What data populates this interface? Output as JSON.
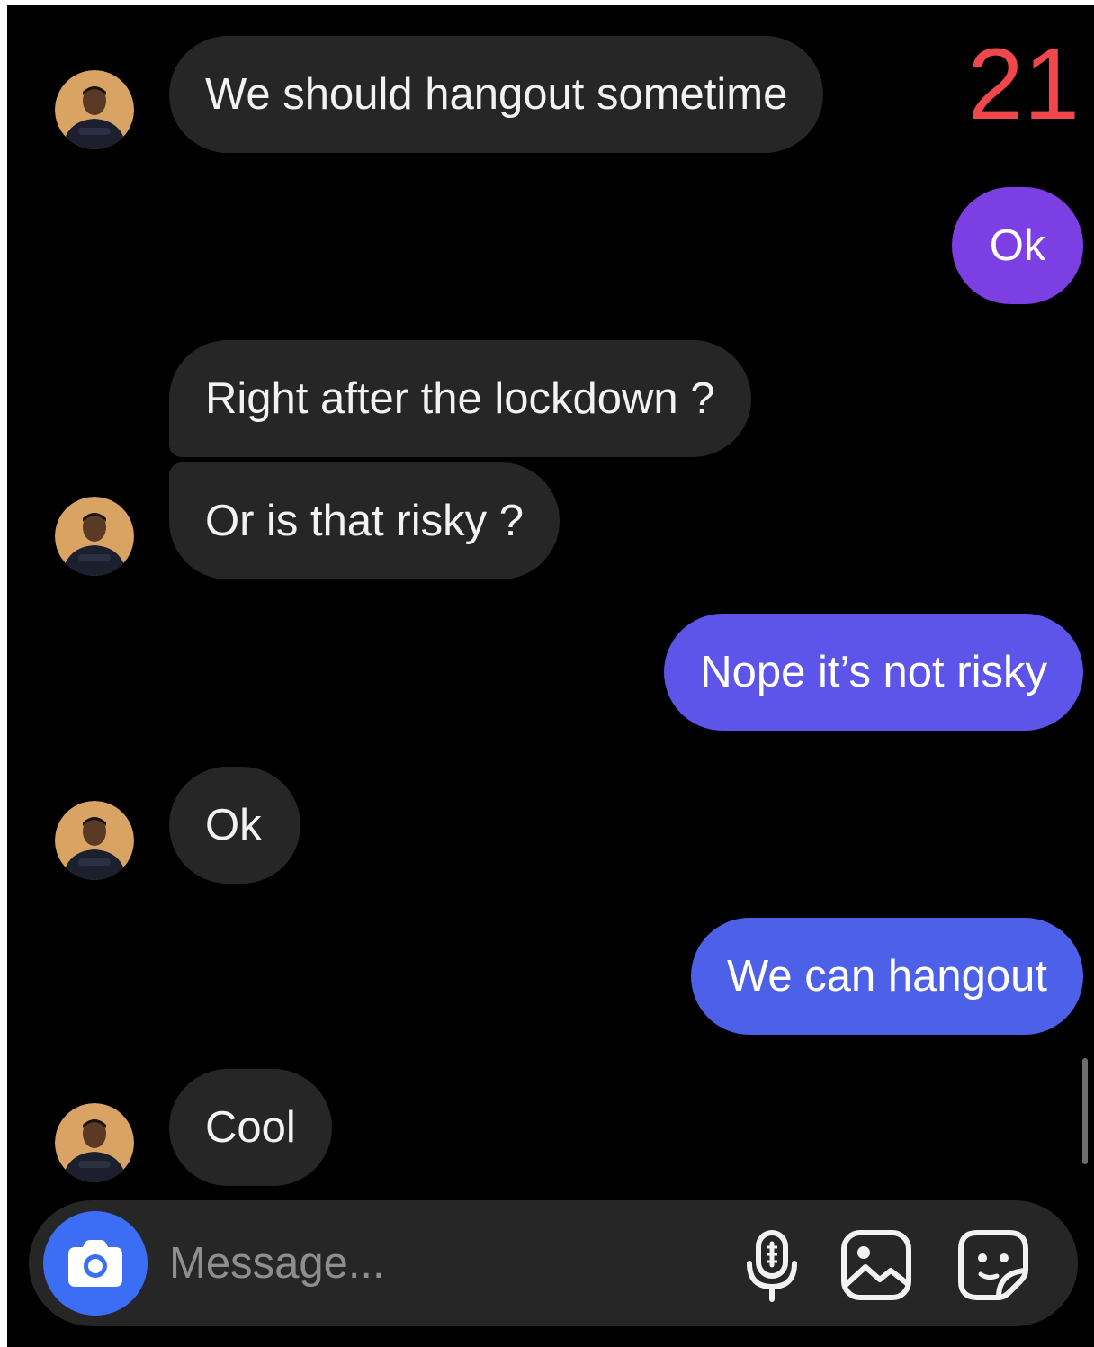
{
  "counter": "21",
  "messages": [
    {
      "text": "We should hangout sometime",
      "side": "incoming"
    },
    {
      "text": "Ok",
      "side": "outgoing"
    },
    {
      "text": "Right after the lockdown ?",
      "side": "incoming"
    },
    {
      "text": "Or is that risky ?",
      "side": "incoming"
    },
    {
      "text": "Nope it’s not risky",
      "side": "outgoing"
    },
    {
      "text": "Ok",
      "side": "incoming"
    },
    {
      "text": "We can hangout",
      "side": "outgoing"
    },
    {
      "text": "Cool",
      "side": "incoming"
    }
  ],
  "composer": {
    "placeholder": "Message...",
    "icons": [
      "camera-icon",
      "microphone-icon",
      "image-icon",
      "sticker-icon"
    ]
  },
  "colors": {
    "background": "#000000",
    "incoming_bubble": "#262626",
    "outgoing_gradient": [
      "#7b3fe4",
      "#6a4fe8",
      "#5d54ea",
      "#4d61e8"
    ],
    "counter": "#f0474d",
    "camera_button": "#3b6ef5"
  }
}
